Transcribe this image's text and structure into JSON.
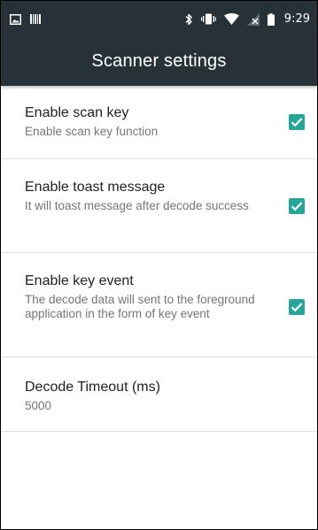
{
  "status_bar": {
    "time": "9:29",
    "icons": [
      "image-icon",
      "barcode-icon",
      "bluetooth-icon",
      "vibrate-icon",
      "wifi-icon",
      "no-signal-icon",
      "battery-icon"
    ]
  },
  "action_bar": {
    "title": "Scanner settings"
  },
  "preferences": [
    {
      "title": "Enable scan key",
      "summary": "Enable scan key function",
      "checked": true
    },
    {
      "title": "Enable toast message",
      "summary": "It will toast message after decode success",
      "checked": true
    },
    {
      "title": "Enable key event",
      "summary": "The decode data will sent to the foreground application in the form of key event",
      "checked": true
    },
    {
      "title": "Decode Timeout (ms)",
      "summary": "5000"
    }
  ],
  "colors": {
    "bar_background": "#263238",
    "checkbox_accent": "#26a69a",
    "title_text": "#212121",
    "summary_text": "#757575"
  }
}
